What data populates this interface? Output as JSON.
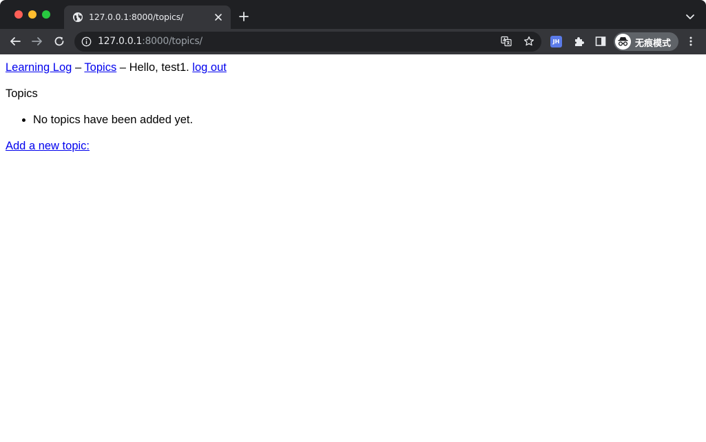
{
  "browser": {
    "tab_title": "127.0.0.1:8000/topics/",
    "url_host": "127.0.0.1",
    "url_path": ":8000/topics/",
    "extension_label": "JH",
    "profile_label": "无痕模式",
    "colors": {
      "tabstrip": "#1f2023",
      "toolbar": "#35363a",
      "omnibox": "#202124"
    }
  },
  "page": {
    "nav": {
      "home_link": "Learning Log",
      "separator_1": "–",
      "topics_link": "Topics",
      "separator_2": "–",
      "greeting": "Hello, test1.",
      "logout_link": "log out"
    },
    "heading": "Topics",
    "topics": {
      "empty_message": "No topics have been added yet."
    },
    "add_topic_link": "Add a new topic:",
    "link_color": "#0000ee"
  }
}
